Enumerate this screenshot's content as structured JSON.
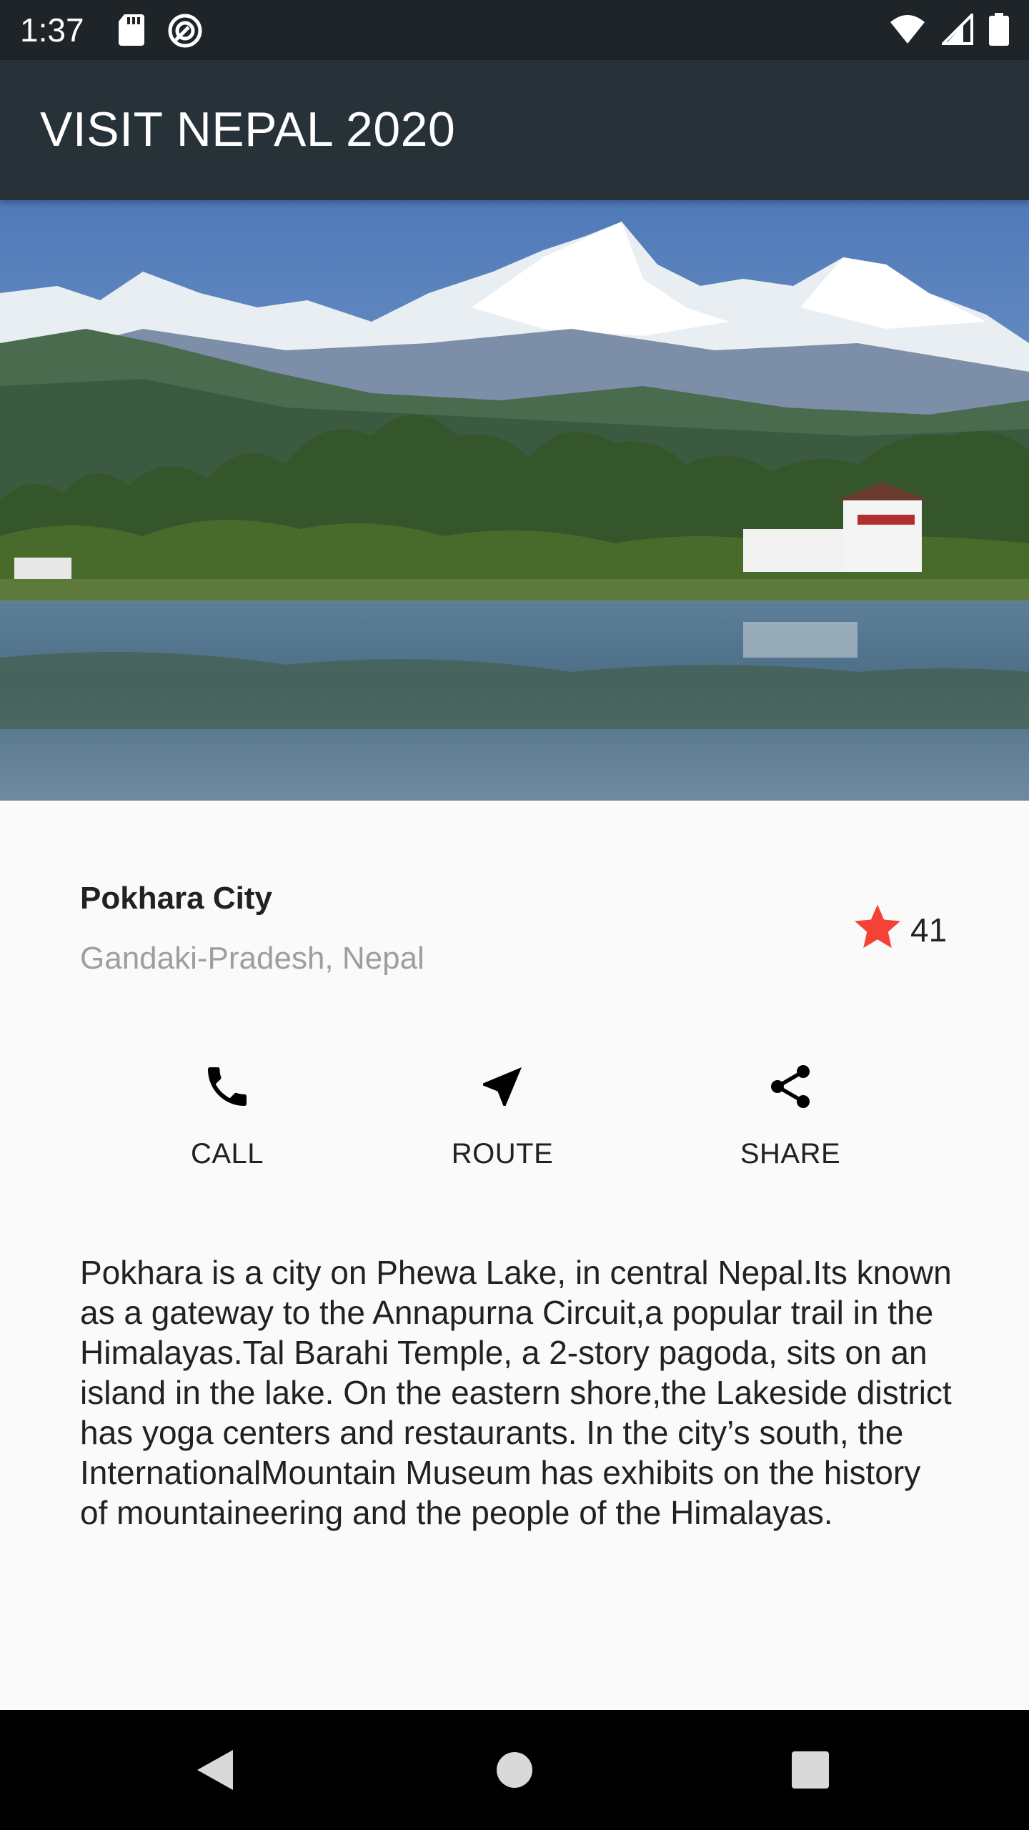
{
  "status_bar": {
    "time": "1:37",
    "left_icons": [
      "sd-card-icon",
      "sync-icon"
    ],
    "right_icons": [
      "wifi-icon",
      "signal-icon",
      "battery-icon"
    ]
  },
  "app_bar": {
    "title": "VISIT NEPAL 2020",
    "background": "#263238"
  },
  "hero": {
    "image": "pokhara-lake-mountain-image"
  },
  "place": {
    "name": "Pokhara City",
    "location": "Gandaki-Pradesh, Nepal",
    "rating_icon": "star-icon",
    "rating_count": "41",
    "star_color": "#f44336"
  },
  "actions": [
    {
      "label": "CALL",
      "icon": "phone-icon"
    },
    {
      "label": "ROUTE",
      "icon": "navigation-icon"
    },
    {
      "label": "SHARE",
      "icon": "share-icon"
    }
  ],
  "description": "Pokhara is a city on Phewa Lake, in central Nepal.Its known as a gateway to the Annapurna Circuit,a popular trail in the Himalayas.Tal Barahi Temple, a 2-story pagoda, sits on an island in the lake. On the eastern shore,the Lakeside district has yoga centers and restaurants. In the city’s south, the InternationalMountain Museum has exhibits on the history of mountaineering and the people of the Himalayas.",
  "nav_bar": {
    "buttons": [
      "back-icon",
      "home-icon",
      "recents-icon"
    ]
  }
}
